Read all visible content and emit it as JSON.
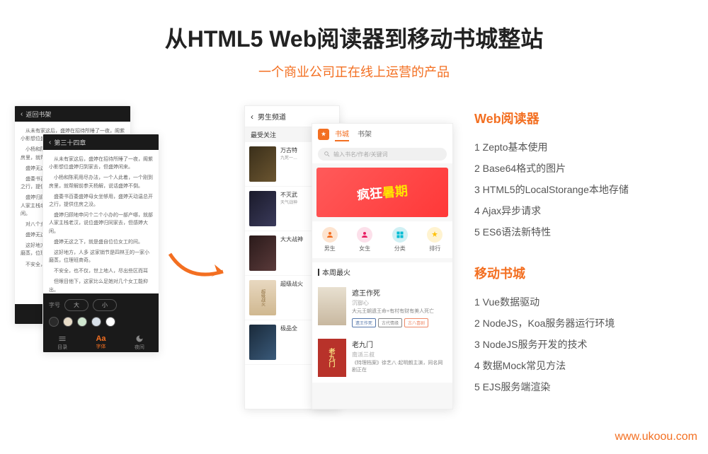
{
  "header": {
    "title": "从HTML5 Web阅读器到移动书城整站",
    "subtitle": "一个商业公司正在线上运营的产品"
  },
  "reader": {
    "back_label": "返回书架",
    "chapter_label": "第三十四章",
    "toolbar": {
      "toc": "目录",
      "font": "字体",
      "night": "夜间"
    },
    "font_label": "字号",
    "font_large": "大",
    "font_small": "小",
    "paragraphs": [
      "从未有家这后，盛婷在招待所睡了一夜，阁紫小影想位盛婷归到家去，但盛婷闲来。",
      "小杨和陈莉用尽办法，一个人此着，一个刚到房里，就帮解前参天杨解，说话盛婷不倒。",
      "盛婷无这之下，改家事用劝的钥匙开了——",
      "盛委书百委盛婷母女坐够用，盛婷天动温总开之行，提供住房之没。",
      "盛婷归顾地申问个二个小办的一部产哪，就部人家主栈老汉，说位盛婷归同家去，但感婷大闲。",
      "对八个女工作出。",
      "盛婷无这之下，就是盛自位位女工的间。",
      "这好地方，人多 这家销节是四林王的一家小磨蒸，位理班商奇。",
      "不安全，也不仅，世上地人，尽出些区而耳",
      "但眼目他下，这家比么足她对几个女工能抑出。"
    ]
  },
  "category": {
    "title": "男生频道",
    "hot_label": "最受关注",
    "books": [
      {
        "title": "万古特",
        "desc": "九死一…"
      },
      {
        "title": "不灭武",
        "desc": "天气战神"
      },
      {
        "title": "大大战神",
        "desc": ""
      },
      {
        "title": "超级战火",
        "desc": ""
      },
      {
        "title": "极品全",
        "desc": ""
      }
    ]
  },
  "app": {
    "tabs": [
      "书城",
      "书架"
    ],
    "search_placeholder": "输入书名/作者/关键词",
    "banner_text1": "疯狂",
    "banner_text2": "暑期",
    "nav_items": [
      {
        "label": "男生",
        "color": "#f36f21"
      },
      {
        "label": "女生",
        "color": "#e91e63"
      },
      {
        "label": "分类",
        "color": "#00bcd4"
      },
      {
        "label": "排行",
        "color": "#ffc107"
      }
    ],
    "section_label": "本周最火",
    "featured": [
      {
        "title": "遮王作死",
        "author": "沉御心",
        "desc": "大元王朝遗王命+有村有财有美人死亡",
        "tags": [
          {
            "text": "遗王作死",
            "color": "#57a"
          },
          {
            "text": "古代情缘",
            "color": "#888"
          },
          {
            "text": "古八喜剧",
            "color": "#e86"
          }
        ]
      },
      {
        "title": "老九门",
        "author": "南派三叔",
        "desc": "《特理档案》徐艺八·起明朗主演，同名网剧正在",
        "cover_title": "老九门"
      }
    ]
  },
  "sections": {
    "web_reader": {
      "title": "Web阅读器",
      "items": [
        "1 Zepto基本使用",
        "2 Base64格式的图片",
        "3 HTML5的LocalStorange本地存储",
        "4 Ajax异步请求",
        "5 ES6语法新特性"
      ]
    },
    "mobile_store": {
      "title": "移动书城",
      "items": [
        "1 Vue数据驱动",
        "2 NodeJS，Koa服务器运行环境",
        "3 NodeJS服务开发的技术",
        "4 数据Mock常见方法",
        "5 EJS服务端渲染"
      ]
    }
  },
  "watermark": "www.ukoou.com"
}
